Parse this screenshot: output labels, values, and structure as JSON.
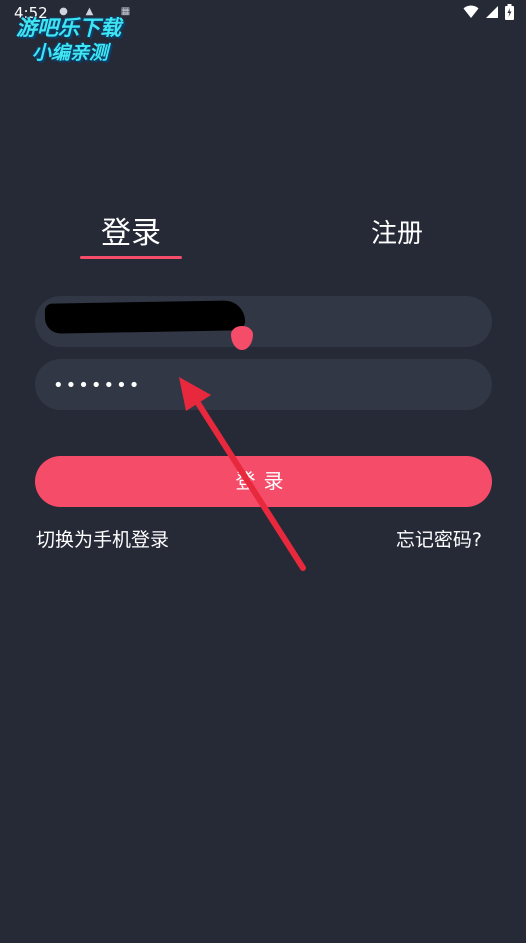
{
  "status_bar": {
    "time": "4:52"
  },
  "watermark": {
    "line1": "游吧乐下载",
    "line2": "小编亲测"
  },
  "tabs": {
    "login_label": "登录",
    "register_label": "注册"
  },
  "form": {
    "password_value": "•••••••",
    "login_button_label": "登录"
  },
  "links": {
    "switch_login": "切换为手机登录",
    "forgot_password": "忘记密码?"
  },
  "colors": {
    "background": "#262a37",
    "field_background": "#323745",
    "accent": "#f54d69",
    "annotation_arrow": "#e8293d"
  }
}
